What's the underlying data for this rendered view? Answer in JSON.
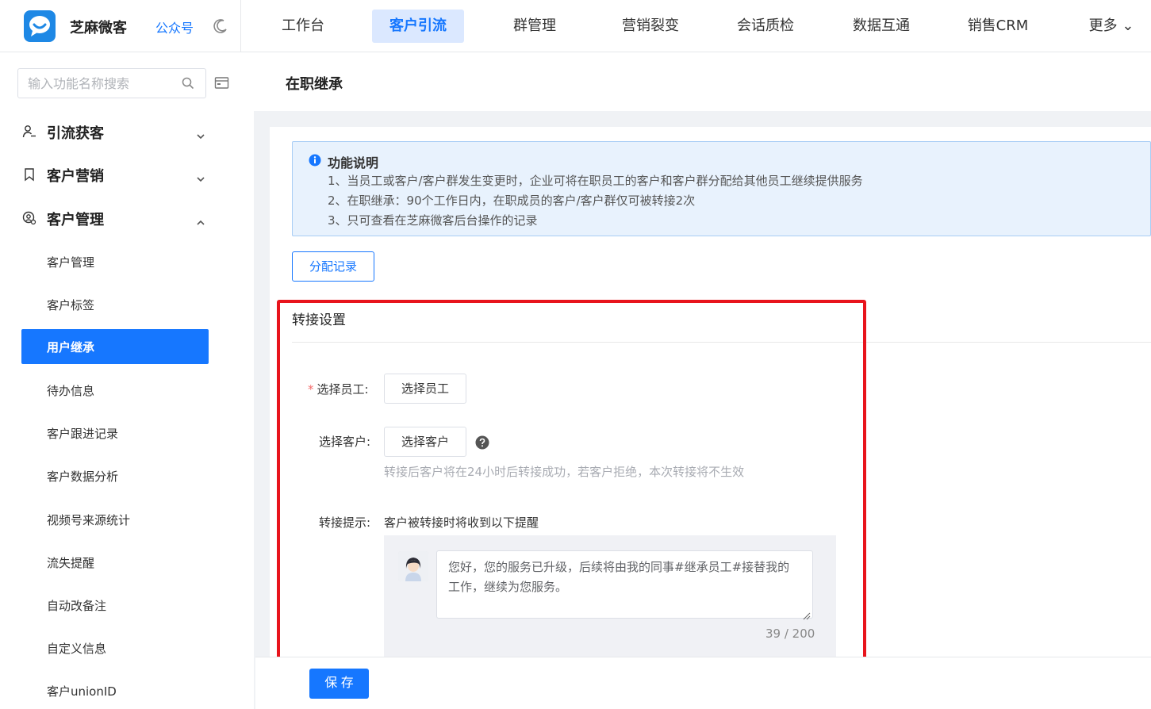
{
  "header": {
    "brand_name": "芝麻微客",
    "brand_link": "公众号",
    "nav": [
      {
        "label": "工作台"
      },
      {
        "label": "客户引流"
      },
      {
        "label": "群管理"
      },
      {
        "label": "营销裂变"
      },
      {
        "label": "会话质检"
      },
      {
        "label": "数据互通"
      },
      {
        "label": "销售CRM"
      },
      {
        "label": "更多 ⌄"
      }
    ],
    "active_nav": "客户引流"
  },
  "sidebar": {
    "search_placeholder": "输入功能名称搜索",
    "groups": [
      {
        "label": "引流获客",
        "icon": "user-plus-icon",
        "expanded": false
      },
      {
        "label": "客户营销",
        "icon": "bookmark-icon",
        "expanded": false
      },
      {
        "label": "客户管理",
        "icon": "customer-manage-icon",
        "expanded": true
      }
    ],
    "items": [
      {
        "label": "客户管理"
      },
      {
        "label": "客户标签"
      },
      {
        "label": "用户继承"
      },
      {
        "label": "待办信息"
      },
      {
        "label": "客户跟进记录"
      },
      {
        "label": "客户数据分析"
      },
      {
        "label": "视频号来源统计"
      },
      {
        "label": "流失提醒"
      },
      {
        "label": "自动改备注"
      },
      {
        "label": "自定义信息"
      },
      {
        "label": "客户unionID"
      }
    ],
    "active_item": "用户继承"
  },
  "page": {
    "title": "在职继承",
    "notice": {
      "title": "功能说明",
      "lines": [
        "1、当员工或客户/客户群发生变更时，企业可将在职员工的客户和客户群分配给其他员工继续提供服务",
        "2、在职继承：90个工作日内，在职成员的客户/客户群仅可被转接2次",
        "3、只可查看在芝麻微客后台操作的记录"
      ]
    },
    "records_button": "分配记录",
    "section_title": "转接设置",
    "form": {
      "employee_label": "选择员工:",
      "employee_required": "*",
      "employee_button": "选择员工",
      "customer_label": "选择客户:",
      "customer_button": "选择客户",
      "customer_hint": "转接后客户将在24小时后转接成功，若客户拒绝，本次转接将不生效",
      "tip_label": "转接提示:",
      "tip_desc": "客户被转接时将收到以下提醒",
      "message": "您好，您的服务已升级，后续将由我的同事#继承员工#接替我的工作，继续为您服务。",
      "counter": "39 / 200"
    },
    "save_button": "保 存"
  },
  "colors": {
    "primary": "#1677ff",
    "highlight_border": "#e8141c",
    "notice_bg": "#e8f2fd"
  }
}
